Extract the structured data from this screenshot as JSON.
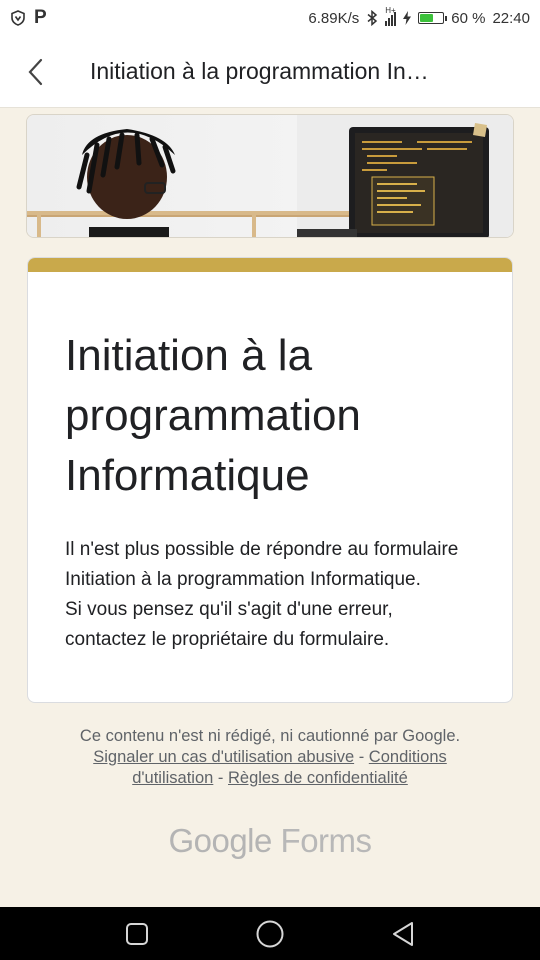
{
  "status_bar": {
    "carrier_icon": "P",
    "net_speed": "6.89K/s",
    "battery_percent": "60 %",
    "battery_level": 0.6,
    "time": "22:40",
    "signal_label": "H+"
  },
  "app_bar": {
    "title": "Initiation à la programmation In…"
  },
  "card": {
    "title": "Initiation à la programmation Informatique",
    "message_line1": "Il n'est plus possible de répondre au formulaire Initiation à la programmation Informatique.",
    "message_line2": "Si vous pensez qu'il s'agit d'une erreur, contactez le propriétaire du formulaire.",
    "accent_color": "#c9a94b"
  },
  "footer": {
    "disclaimer": "Ce contenu n'est ni rédigé, ni cautionné par Google.",
    "link_abuse": "Signaler un cas d'utilisation abusive",
    "sep1": " - ",
    "link_terms": "Conditions d'utilisation",
    "sep2": " - ",
    "link_privacy": "Règles de confidentialité"
  },
  "branding": {
    "google": "Google",
    "forms": "Forms"
  },
  "nav_bar": {
    "icons": [
      "recents-square-icon",
      "home-circle-icon",
      "back-triangle-icon"
    ]
  }
}
